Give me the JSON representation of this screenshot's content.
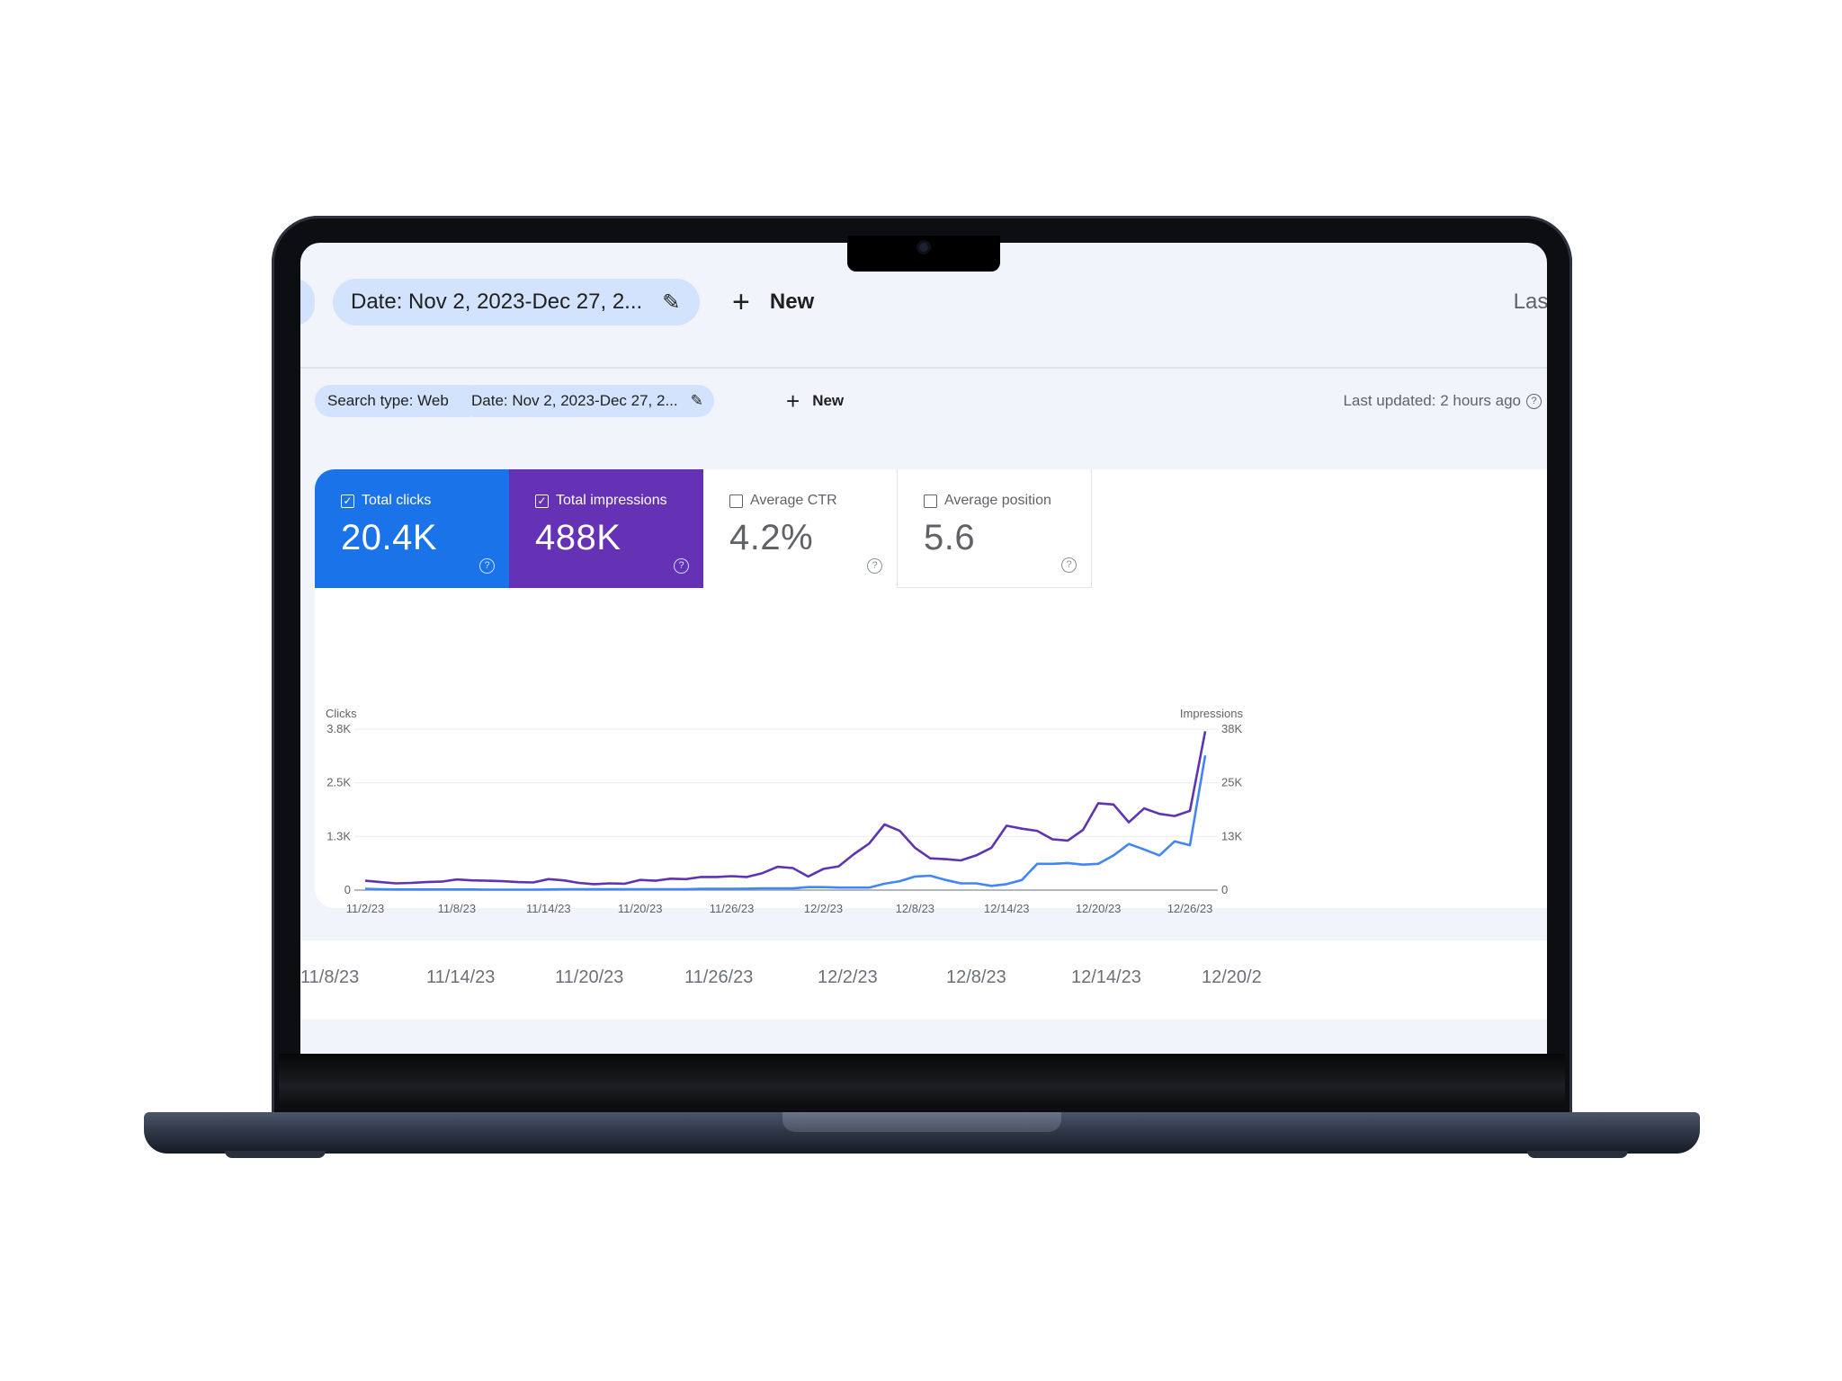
{
  "device": "laptop",
  "background_layer": {
    "date_chip": "Date: Nov 2, 2023-Dec 27, 2...",
    "new_label": "New",
    "last_text": "Last",
    "dates": [
      "11/8/23",
      "11/14/23",
      "11/20/23",
      "11/26/23",
      "12/2/23",
      "12/8/23",
      "12/14/23",
      "12/20/2"
    ]
  },
  "filters": {
    "search_type": "Search type: Web",
    "date": "Date: Nov 2, 2023-Dec 27, 2...",
    "new_label": "New",
    "last_updated": "Last updated: 2 hours ago",
    "help_glyph": "?"
  },
  "metrics": [
    {
      "label": "Total clicks",
      "value": "20.4K",
      "checked": true,
      "color": "#1a73e8"
    },
    {
      "label": "Total impressions",
      "value": "488K",
      "checked": true,
      "color": "#6531b5"
    },
    {
      "label": "Average CTR",
      "value": "4.2%",
      "checked": false,
      "color": "#ffffff"
    },
    {
      "label": "Average position",
      "value": "5.6",
      "checked": false,
      "color": "#ffffff"
    }
  ],
  "icons": {
    "check": "✓",
    "plus": "+",
    "edit": "✎",
    "help": "?"
  },
  "chart_data": {
    "type": "line",
    "title": "",
    "left_axis_label": "Clicks",
    "right_axis_label": "Impressions",
    "left_ticks": [
      "0",
      "1.3K",
      "2.5K",
      "3.8K"
    ],
    "right_ticks": [
      "0",
      "13K",
      "25K",
      "38K"
    ],
    "left_range": [
      0,
      3800
    ],
    "right_range": [
      0,
      38000
    ],
    "x_ticks": [
      "11/2/23",
      "11/8/23",
      "11/14/23",
      "11/20/23",
      "11/26/23",
      "12/2/23",
      "12/8/23",
      "12/14/23",
      "12/20/23",
      "12/26/23"
    ],
    "x_start": "11/2/23",
    "x_end": "12/27/23",
    "grid": true,
    "series": [
      {
        "name": "Impressions",
        "axis": "right",
        "color": "#5e35b1",
        "values": [
          2200,
          1900,
          1600,
          1700,
          1900,
          2000,
          2500,
          2300,
          2200,
          2100,
          1900,
          1800,
          2600,
          2300,
          1700,
          1400,
          1600,
          1500,
          2400,
          2200,
          2700,
          2600,
          3100,
          3100,
          3300,
          3100,
          4000,
          5500,
          5200,
          3200,
          5000,
          5600,
          8500,
          11000,
          15500,
          14000,
          10000,
          7500,
          7300,
          7000,
          8200,
          10000,
          15200,
          14500,
          14000,
          12000,
          11700,
          14200,
          20500,
          20200,
          16000,
          19300,
          18000,
          17500,
          18700,
          37500
        ]
      },
      {
        "name": "Clicks",
        "axis": "left",
        "color": "#4285f4",
        "values": [
          30,
          20,
          15,
          15,
          15,
          15,
          15,
          15,
          10,
          10,
          10,
          10,
          15,
          20,
          20,
          20,
          20,
          20,
          20,
          20,
          20,
          20,
          30,
          30,
          30,
          35,
          40,
          40,
          40,
          70,
          70,
          60,
          60,
          60,
          150,
          210,
          320,
          340,
          240,
          160,
          160,
          100,
          140,
          240,
          620,
          620,
          640,
          600,
          620,
          820,
          1090,
          960,
          820,
          1150,
          1060,
          3180
        ]
      }
    ]
  }
}
